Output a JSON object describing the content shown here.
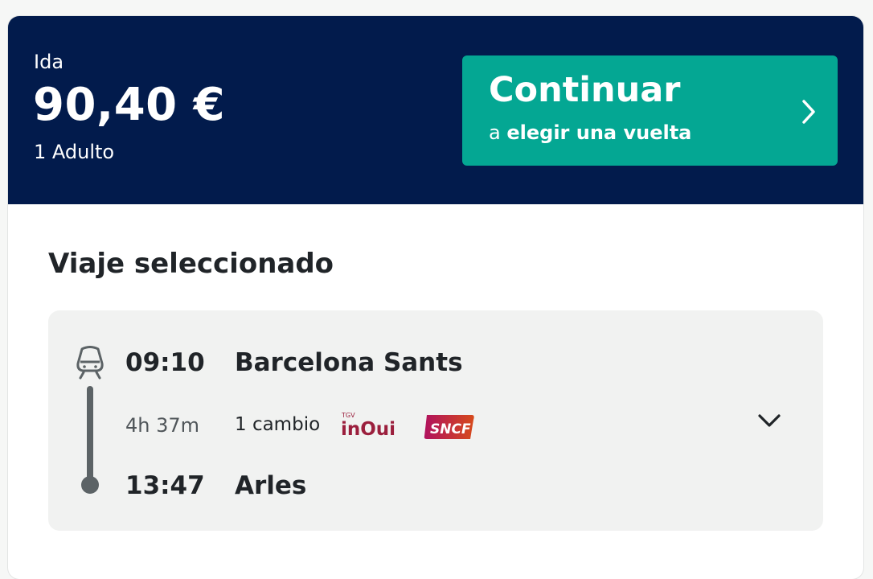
{
  "summary": {
    "label": "Ida",
    "price": "90,40 €",
    "passengers": "1 Adulto"
  },
  "continue_button": {
    "title": "Continuar",
    "subtitle_prefix": "a",
    "subtitle_bold": "elegir una vuelta",
    "icon": "chevron-right-icon"
  },
  "section": {
    "title": "Viaje seleccionado"
  },
  "journey": {
    "departure_time": "09:10",
    "departure_station": "Barcelona Sants",
    "duration": "4h 37m",
    "changes": "1 cambio",
    "arrival_time": "13:47",
    "arrival_station": "Arles",
    "operators": [
      {
        "name": "TGV inOui",
        "logo_top": "TGV",
        "logo_main": "inOui"
      },
      {
        "name": "SNCF",
        "logo_main": "SNCF"
      }
    ],
    "expand_icon": "chevron-down-icon"
  },
  "colors": {
    "header_bg": "#021b4c",
    "accent": "#04a793",
    "journey_bg": "#f1f2f1",
    "inoui": "#9b1f3d",
    "sncf_start": "#b0125e",
    "sncf_end": "#d64a1c"
  }
}
